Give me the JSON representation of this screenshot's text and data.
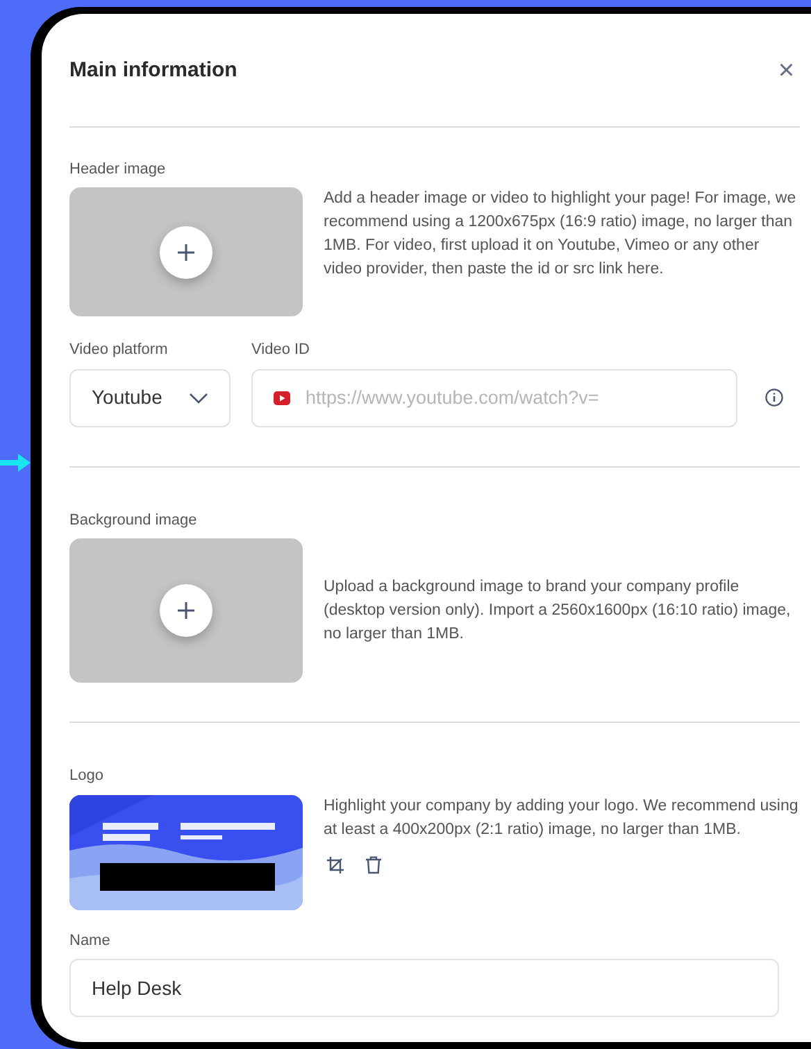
{
  "dialog": {
    "title": "Main information",
    "close": "×"
  },
  "header_image": {
    "label": "Header image",
    "description": "Add a header image or video to highlight your page! For image, we recommend using a 1200x675px (16:9 ratio) image, no larger than 1MB. For video, first upload it on Youtube, Vimeo or any other video provider, then paste the id or src link here."
  },
  "video_platform": {
    "label": "Video platform",
    "value": "Youtube"
  },
  "video_id": {
    "label": "Video ID",
    "placeholder": "https://www.youtube.com/watch?v="
  },
  "background_image": {
    "label": "Background image",
    "description": "Upload a background image to brand your company profile (desktop version only). Import a 2560x1600px (16:10 ratio) image, no larger than 1MB."
  },
  "logo": {
    "label": "Logo",
    "description": "Highlight your company by adding your logo. We recommend using at least a 400x200px (2:1 ratio) image, no larger than 1MB."
  },
  "name": {
    "label": "Name",
    "value": "Help Desk"
  }
}
